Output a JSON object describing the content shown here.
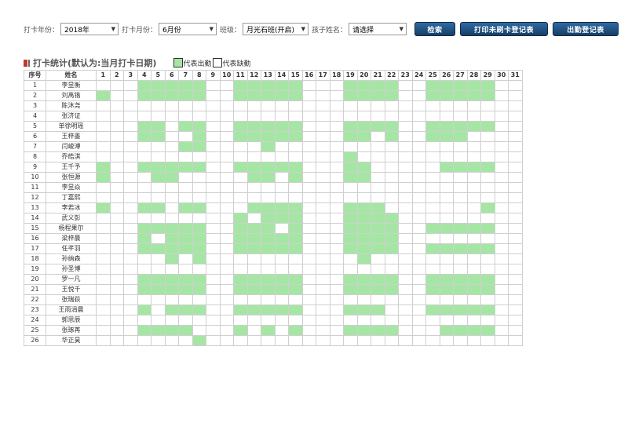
{
  "filters": {
    "year_label": "打卡年份：",
    "year_value": "2018年",
    "month_label": "打卡月份：",
    "month_value": "6月份",
    "class_label": "班级：",
    "class_value": "月光石班(开启)",
    "child_label": "孩子姓名：",
    "child_value": "请选择"
  },
  "buttons": {
    "search": "检索",
    "print": "打印未刷卡登记表",
    "attendance": "出勤登记表"
  },
  "stats": {
    "title": "打卡统计(默认为:当月打卡日期)",
    "legend_present": "代表出勤",
    "legend_absent": "代表缺勤",
    "present_color": "#a5e6a5"
  },
  "table": {
    "col_index": "序号",
    "col_name": "姓名",
    "days": [
      "1",
      "2",
      "3",
      "4",
      "5",
      "6",
      "7",
      "8",
      "9",
      "10",
      "11",
      "12",
      "13",
      "14",
      "15",
      "16",
      "17",
      "18",
      "19",
      "20",
      "21",
      "22",
      "23",
      "24",
      "25",
      "26",
      "27",
      "28",
      "29",
      "30",
      "31"
    ],
    "rows": [
      {
        "no": "1",
        "name": "李昱衡",
        "present": [
          4,
          5,
          6,
          7,
          8,
          11,
          12,
          13,
          14,
          15,
          19,
          20,
          21,
          22,
          25,
          26,
          27,
          28,
          29
        ]
      },
      {
        "no": "2",
        "name": "刘禹锴",
        "present": [
          1,
          4,
          5,
          6,
          7,
          8,
          11,
          12,
          13,
          14,
          15,
          19,
          20,
          21,
          22,
          25,
          26,
          27,
          28,
          29
        ]
      },
      {
        "no": "3",
        "name": "陈沐尧",
        "present": []
      },
      {
        "no": "4",
        "name": "张济证",
        "present": []
      },
      {
        "no": "5",
        "name": "单徐明瑶",
        "present": [
          4,
          5,
          7,
          8,
          11,
          12,
          13,
          14,
          15,
          19,
          20,
          21,
          22,
          25,
          26,
          27,
          28,
          29
        ]
      },
      {
        "no": "6",
        "name": "王梓墨",
        "present": [
          4,
          5,
          8,
          11,
          12,
          13,
          14,
          15,
          19,
          20,
          22,
          25,
          26,
          27
        ]
      },
      {
        "no": "7",
        "name": "闫峻溥",
        "present": [
          7,
          8,
          13
        ]
      },
      {
        "no": "8",
        "name": "乔皓淇",
        "present": [
          19
        ]
      },
      {
        "no": "9",
        "name": "王千予",
        "present": [
          1,
          4,
          5,
          6,
          7,
          8,
          11,
          12,
          13,
          14,
          15,
          19,
          20,
          26,
          27,
          28,
          29
        ]
      },
      {
        "no": "10",
        "name": "张恒源",
        "present": [
          1,
          5,
          6,
          12,
          13,
          15,
          19,
          20
        ]
      },
      {
        "no": "11",
        "name": "李昱焱",
        "present": []
      },
      {
        "no": "12",
        "name": "丁嘉熙",
        "present": []
      },
      {
        "no": "13",
        "name": "李若冰",
        "present": [
          1,
          4,
          5,
          7,
          8,
          12,
          13,
          14,
          15,
          19,
          20,
          21,
          29
        ]
      },
      {
        "no": "14",
        "name": "武义彭",
        "present": [
          11,
          13,
          14,
          15,
          19,
          20,
          21,
          22
        ]
      },
      {
        "no": "15",
        "name": "杨程果尔",
        "present": [
          4,
          5,
          6,
          7,
          8,
          11,
          12,
          13,
          15,
          19,
          20,
          21,
          22,
          25,
          26,
          27,
          28,
          29
        ]
      },
      {
        "no": "16",
        "name": "梁梓晨",
        "present": [
          4,
          6,
          7,
          8,
          11,
          12,
          13,
          14,
          15,
          19,
          20,
          21,
          22
        ]
      },
      {
        "no": "17",
        "name": "任芊羽",
        "present": [
          4,
          5,
          6,
          7,
          8,
          11,
          12,
          13,
          14,
          15,
          19,
          20,
          21,
          22,
          25,
          26,
          27,
          28,
          29
        ]
      },
      {
        "no": "18",
        "name": "孙纳森",
        "present": [
          6,
          8,
          20
        ]
      },
      {
        "no": "19",
        "name": "孙圣博",
        "present": []
      },
      {
        "no": "20",
        "name": "罗一凡",
        "present": [
          4,
          5,
          6,
          7,
          8,
          11,
          12,
          13,
          14,
          15,
          19,
          20,
          21,
          22,
          25,
          26,
          27,
          28,
          29
        ]
      },
      {
        "no": "21",
        "name": "王悦千",
        "present": [
          4,
          5,
          6,
          7,
          8,
          11,
          12,
          13,
          14,
          15,
          19,
          20,
          21,
          22,
          25,
          26,
          27,
          28,
          29
        ]
      },
      {
        "no": "22",
        "name": "张瑞荻",
        "present": []
      },
      {
        "no": "23",
        "name": "王雨涓晨",
        "present": [
          4,
          6,
          7,
          8,
          11,
          12,
          13,
          14,
          15,
          19,
          20,
          21,
          25,
          26,
          27,
          28,
          29
        ]
      },
      {
        "no": "24",
        "name": "郭思辰",
        "present": []
      },
      {
        "no": "25",
        "name": "张琢苒",
        "present": [
          4,
          5,
          6,
          7,
          11,
          13,
          15,
          19,
          20,
          21,
          22,
          26,
          27,
          28,
          29
        ]
      },
      {
        "no": "26",
        "name": "华正昊",
        "present": [
          8
        ]
      }
    ]
  }
}
